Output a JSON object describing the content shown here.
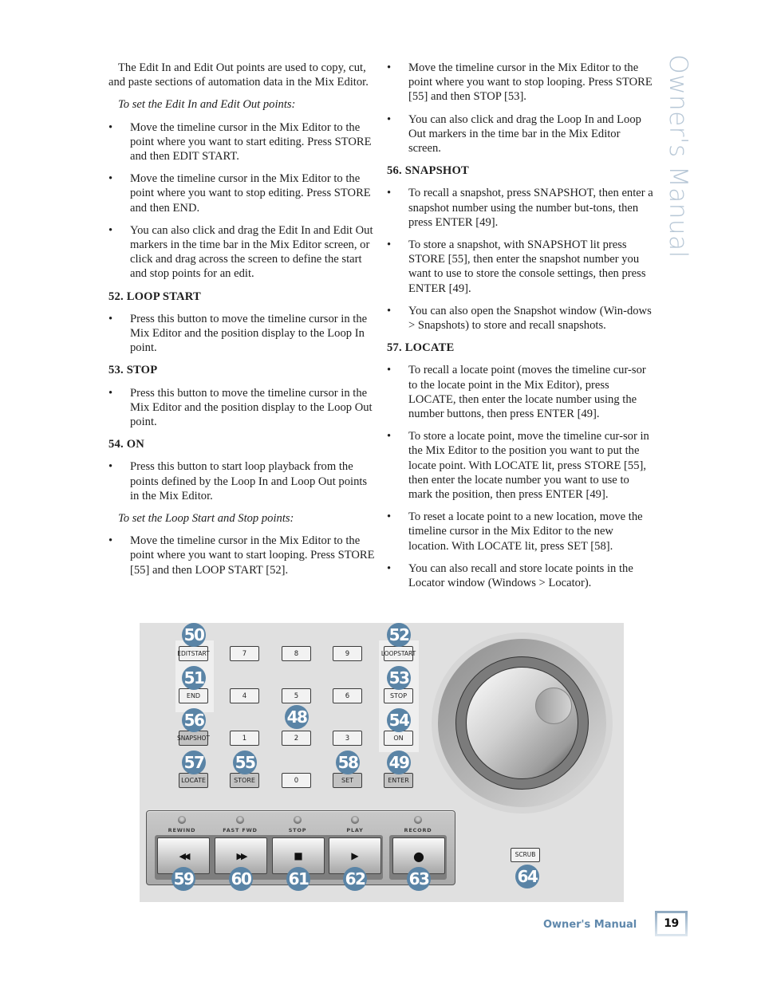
{
  "side_title": "Owner's Manual",
  "left_column": {
    "intro": "The Edit In and Edit Out points are used to copy, cut, and paste sections of automation data in the Mix Editor.",
    "edit_subhead": "To set the Edit In and Edit Out points:",
    "edit_bullets": [
      "Move the timeline cursor in the Mix Editor to the point where you want to start editing. Press STORE and then EDIT START.",
      "Move the timeline cursor in the Mix Editor to the point where you want to stop editing. Press STORE and then END.",
      "You can also click and drag the Edit In and Edit Out markers in the time bar in the Mix Editor screen, or click and drag across the screen to define the start and stop points for an edit."
    ],
    "s52_head": "52. LOOP START",
    "s52_bullet": "Press this button to move the timeline cursor in the Mix Editor and the position display to the Loop In point.",
    "s53_head": "53. STOP",
    "s53_bullet": "Press this button to move the timeline cursor in the Mix Editor and the position display to the Loop Out point.",
    "s54_head": "54. ON",
    "s54_bullet": "Press this button to start loop playback from the points defined by the Loop In and Loop Out points in the Mix Editor.",
    "loop_subhead": "To set the Loop Start and Stop points:",
    "loop_bullet": "Move the timeline cursor in the Mix Editor to the point where you want to start looping. Press STORE [55] and then LOOP START [52]."
  },
  "right_column": {
    "loop_bullets": [
      "Move the timeline cursor in the Mix Editor to the point where you want to stop looping. Press STORE [55] and then STOP [53].",
      "You can also click and drag the Loop In and Loop Out markers in the time bar in the Mix Editor screen."
    ],
    "s56_head": "56. SNAPSHOT",
    "s56_bullets": [
      "To recall a snapshot, press SNAPSHOT, then enter a snapshot number using the number but-tons, then press ENTER [49].",
      "To store a snapshot, with SNAPSHOT lit press STORE [55], then enter the snapshot number you want to use to store the console settings, then press ENTER [49].",
      "You can also open the Snapshot window (Win-dows > Snapshots) to store and recall snapshots."
    ],
    "s57_head": "57. LOCATE",
    "s57_bullets": [
      "To recall a locate point (moves the timeline cur-sor to the locate point in the Mix Editor), press LOCATE, then enter the locate number using the number buttons, then press ENTER [49].",
      "To store a locate point, move the timeline cur-sor in the Mix Editor to the position you want to put the locate point. With LOCATE lit, press STORE [55], then enter the locate number you want to use to mark the position, then press ENTER [49].",
      "To reset a locate point to a new location, move the timeline cursor in the Mix Editor to the new location. With LOCATE lit, press SET [58].",
      "You can also recall and store locate points in the Locator window (Windows > Locator)."
    ]
  },
  "bullet_glyph": "•",
  "diagram": {
    "badge_color": "#5a84a6",
    "keys": {
      "edit_start": [
        "EDIT",
        "START"
      ],
      "end": "END",
      "snapshot": [
        "SNAP",
        "SHOT"
      ],
      "locate": "LOCATE",
      "store": "STORE",
      "set": "SET",
      "loop_start": [
        "LOOP",
        "START"
      ],
      "stop": "STOP",
      "on": "ON",
      "enter": "ENTER",
      "scrub": "SCRUB",
      "digits": [
        "7",
        "8",
        "9",
        "4",
        "5",
        "6",
        "1",
        "2",
        "3",
        "0"
      ]
    },
    "badges": {
      "edit_start": "50",
      "end": "51",
      "snapshot": "56",
      "locate": "57",
      "store": "55",
      "numpad": "48",
      "set": "58",
      "loop_start": "52",
      "stop": "53",
      "on": "54",
      "enter": "49",
      "rewind": "59",
      "fast_fwd": "60",
      "transport_stop": "61",
      "play": "62",
      "record": "63",
      "scrub": "64"
    },
    "transport": {
      "labels": [
        "REWIND",
        "FAST FWD",
        "STOP",
        "PLAY",
        "RECORD"
      ],
      "glyphs": [
        "◀◀",
        "▶▶",
        "■",
        "▶",
        "●"
      ]
    }
  },
  "footer": {
    "label": "Owner's Manual",
    "page_number": "19"
  }
}
